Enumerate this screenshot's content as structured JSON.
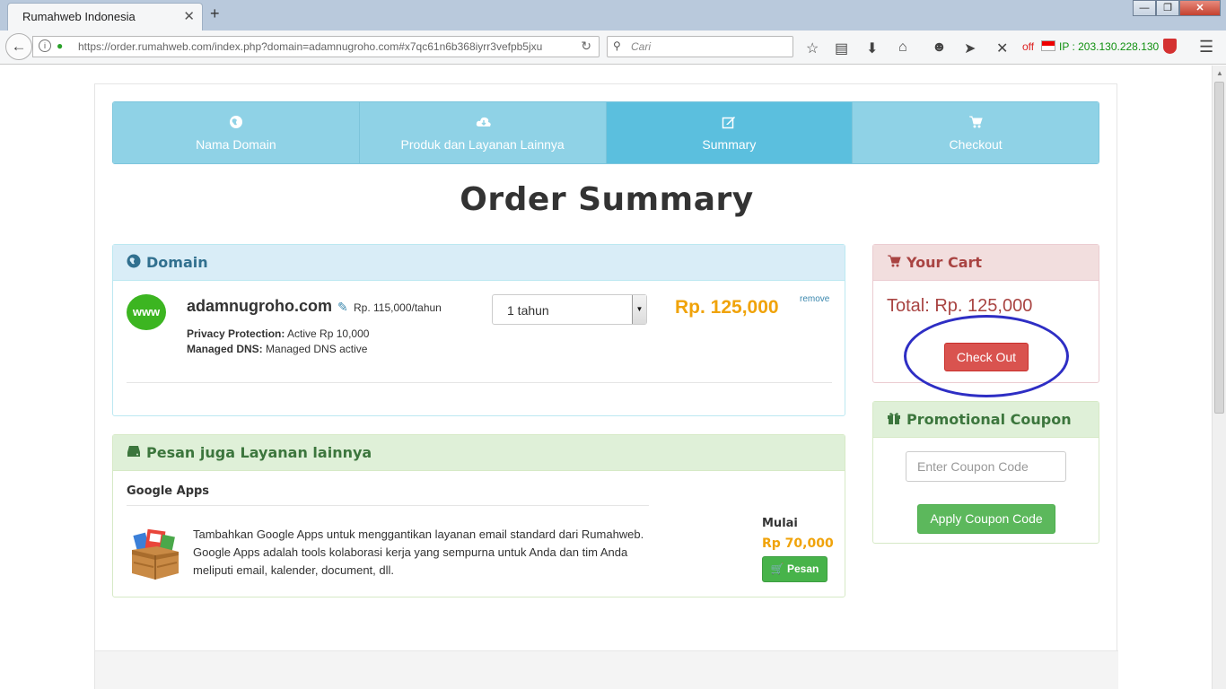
{
  "browser": {
    "tab_title": "Rumahweb Indonesia",
    "tab_close": "✕",
    "new_tab": "+",
    "url": "https://order.rumahweb.com/index.php?domain=adamnugroho.com#x7qc61n6b368iyrr3vefpb5jxu",
    "search_placeholder": "Cari",
    "addon_off": "off",
    "ip_label": "IP : 203.130.228.130",
    "window_controls": {
      "minimize": "—",
      "maximize": "❐",
      "close": "✕"
    }
  },
  "steps": [
    {
      "label": "Nama Domain",
      "icon": "globe-icon",
      "active": false
    },
    {
      "label": "Produk dan Layanan Lainnya",
      "icon": "cloud-download-icon",
      "active": false
    },
    {
      "label": "Summary",
      "icon": "edit-icon",
      "active": true
    },
    {
      "label": "Checkout",
      "icon": "cart-icon",
      "active": false
    }
  ],
  "page_title": "Order Summary",
  "domain_panel": {
    "heading": "Domain",
    "badge": "www",
    "domain_name": "adamnugroho.com",
    "unit_price": "Rp. 115,000/tahun",
    "privacy_label": "Privacy Protection:",
    "privacy_value": " Active Rp 10,000",
    "dns_label": "Managed DNS:",
    "dns_value": " Managed DNS active",
    "period_selected": "1 tahun",
    "total": "Rp. 125,000",
    "remove_label": "remove"
  },
  "addon_panel": {
    "heading": "Pesan juga Layanan lainnya",
    "product_name": "Google Apps",
    "description": "Tambahkan Google Apps untuk menggantikan layanan email standard dari Rumahweb. Google Apps adalah tools kolaborasi kerja yang sempurna untuk Anda dan tim Anda meliputi email, kalender, document, dll.",
    "price_prefix": "Mulai",
    "price": "Rp 70,000",
    "order_button": "Pesan"
  },
  "cart_panel": {
    "heading": "Your Cart",
    "total": "Total: Rp. 125,000",
    "checkout_button": "Check Out"
  },
  "coupon_panel": {
    "heading": "Promotional Coupon",
    "input_placeholder": "Enter Coupon Code",
    "apply_button": "Apply Coupon Code"
  },
  "colors": {
    "step_bg": "#8fd2e6",
    "step_active_bg": "#5bbfde",
    "price_orange": "#f0a30a",
    "checkout_red": "#d9534f",
    "apply_green": "#5cb85c",
    "annotation_circle": "#2e2ec4"
  }
}
